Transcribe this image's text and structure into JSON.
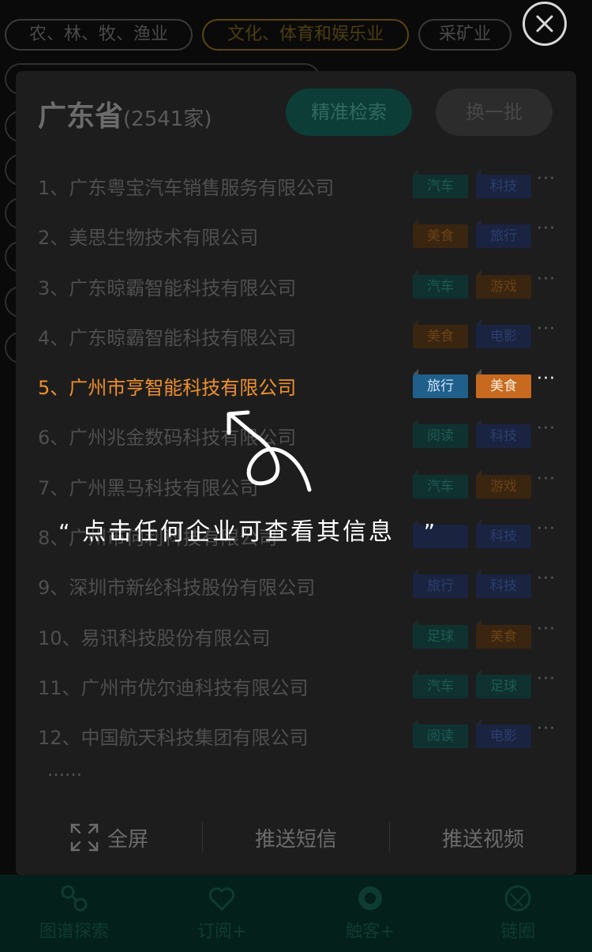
{
  "background": {
    "top_tags": [
      "农、林、牧、渔业",
      "文化、体育和娱乐业",
      "采矿业"
    ],
    "active_tag_index": 1
  },
  "panel": {
    "province": "广东省",
    "count_text": "(2541家)",
    "precise_search_label": "精准检索",
    "refresh_label": "换一批",
    "companies": [
      {
        "index_label": "1、",
        "name": "广东粤宝汽车销售服务有限公司",
        "tags": [
          "汽车",
          "科技"
        ]
      },
      {
        "index_label": "2、",
        "name": "美思生物技术有限公司",
        "tags": [
          "美食",
          "旅行"
        ]
      },
      {
        "index_label": "3、",
        "name": "广东晾霸智能科技有限公司",
        "tags": [
          "汽车",
          "游戏"
        ]
      },
      {
        "index_label": "4、",
        "name": "广东晾霸智能科技有限公司",
        "tags": [
          "美食",
          "电影"
        ]
      },
      {
        "index_label": "5、",
        "name": "广州市亨智能科技有限公司",
        "tags": [
          "旅行",
          "美食"
        ]
      },
      {
        "index_label": "6、",
        "name": "广州兆金数码科技有限公司",
        "tags": [
          "阅读",
          "科技"
        ]
      },
      {
        "index_label": "7、",
        "name": "广州黑马科技有限公司",
        "tags": [
          "汽车",
          "游戏"
        ]
      },
      {
        "index_label": "8、",
        "name": "广州市何利科技有限公司",
        "tags": [
          "",
          "科技"
        ]
      },
      {
        "index_label": "9、",
        "name": "深圳市新纶科技股份有限公司",
        "tags": [
          "旅行",
          "科技"
        ]
      },
      {
        "index_label": "10、",
        "name": "易讯科技股份有限公司",
        "tags": [
          "足球",
          "美食"
        ]
      },
      {
        "index_label": "11、",
        "name": "广州市优尔迪科技有限公司",
        "tags": [
          "汽车",
          "足球"
        ]
      },
      {
        "index_label": "12、",
        "name": "中国航天科技集团有限公司",
        "tags": [
          "阅读",
          "电影"
        ]
      }
    ],
    "more_label": "···",
    "ellipsis": "……",
    "footer": {
      "fullscreen_label": "全屏",
      "push_sms_label": "推送短信",
      "push_video_label": "推送视频"
    }
  },
  "hint": {
    "open_quote": "“",
    "text": "点击任何企业可查看其信息",
    "close_quote": "”"
  },
  "bottom_nav": {
    "items": [
      "图谱探索",
      "订阅+",
      "触客+",
      "链圈"
    ]
  },
  "colors": {
    "highlight": "#f0902a",
    "tag_blue_bg": "#1f5f8a",
    "tag_orange_bg": "#c7691f"
  }
}
